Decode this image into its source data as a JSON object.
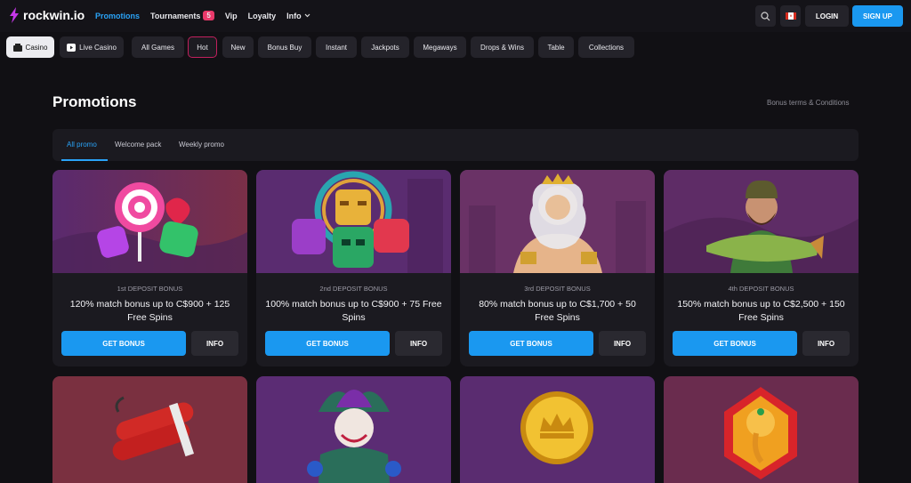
{
  "brand": {
    "name": "rockwin.io"
  },
  "nav": {
    "items": [
      {
        "label": "Promotions",
        "active": true
      },
      {
        "label": "Tournaments",
        "badge": "5"
      },
      {
        "label": "Vip"
      },
      {
        "label": "Loyalty"
      },
      {
        "label": "Info"
      }
    ]
  },
  "header": {
    "login": "LOGIN",
    "signup": "SIGN UP",
    "accent": "#1a98f0"
  },
  "categories": [
    "Casino",
    "Live Casino",
    "All Games",
    "Hot",
    "New",
    "Bonus Buy",
    "Instant",
    "Jackpots",
    "Megaways",
    "Drops & Wins",
    "Table",
    "Collections"
  ],
  "page": {
    "title": "Promotions",
    "terms": "Bonus terms & Conditions"
  },
  "tabs": [
    "All promo",
    "Welcome pack",
    "Weekly promo"
  ],
  "promos": [
    {
      "label": "1st DEPOSIT BONUS",
      "offer": "120% match bonus up to C$900 + 125 Free Spins",
      "cta": "GET BONUS",
      "info": "INFO",
      "icon": "candy-icon"
    },
    {
      "label": "2nd DEPOSIT BONUS",
      "offer": "100% match bonus up to C$900 + 75 Free Spins",
      "cta": "GET BONUS",
      "info": "INFO",
      "icon": "aztec-mask-icon"
    },
    {
      "label": "3rd DEPOSIT BONUS",
      "offer": "80% match bonus up to C$1,700 + 50 Free Spins",
      "cta": "GET BONUS",
      "info": "INFO",
      "icon": "zeus-icon"
    },
    {
      "label": "4th DEPOSIT BONUS",
      "offer": "150% match bonus up to C$2,500 + 150 Free Spins",
      "cta": "GET BONUS",
      "info": "INFO",
      "icon": "fisherman-icon"
    }
  ],
  "promos_row2": [
    {
      "icon": "dynamite-icon"
    },
    {
      "icon": "joker-icon"
    },
    {
      "icon": "gold-coin-icon"
    },
    {
      "icon": "ganesha-icon"
    }
  ]
}
